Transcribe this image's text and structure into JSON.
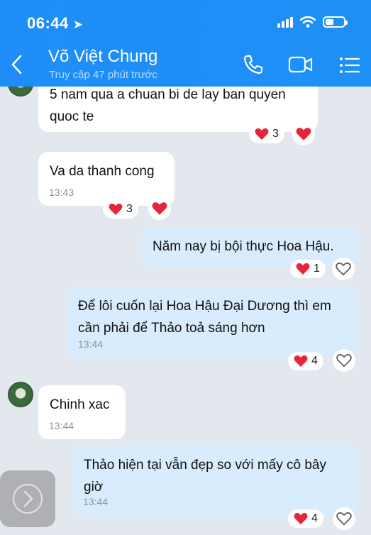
{
  "status": {
    "time": "06:44"
  },
  "header": {
    "name": "Võ Việt Chung",
    "subtitle": "Truy cập 47 phút trước"
  },
  "messages": [
    {
      "dir": "in",
      "text": "5 nam qua a chuan bi de lay ban quyen quoc te",
      "time": "",
      "reaction_count": "3"
    },
    {
      "dir": "in",
      "text": "Va da thanh cong",
      "time": "13:43",
      "reaction_count": "3"
    },
    {
      "dir": "out",
      "text": "Năm nay bị bội thực Hoa Hậu.",
      "time": "",
      "reaction_count": "1"
    },
    {
      "dir": "out",
      "text": "Để lôi cuốn lại Hoa Hậu Đại Dương thì em cần phải để Thảo toả sáng hơn",
      "time": "13:44",
      "reaction_count": "4"
    },
    {
      "dir": "in",
      "text": "Chinh xac",
      "time": "13:44",
      "reaction_count": ""
    },
    {
      "dir": "out",
      "text": "Thảo hiện tại vẫn đẹp so với mấy cô bây giờ",
      "time": "13:44",
      "reaction_count": "4"
    }
  ],
  "colors": {
    "header": "#1f8df7",
    "out_bubble": "#d8ecfd",
    "in_bubble": "#ffffff",
    "heart": "#e8243c"
  }
}
